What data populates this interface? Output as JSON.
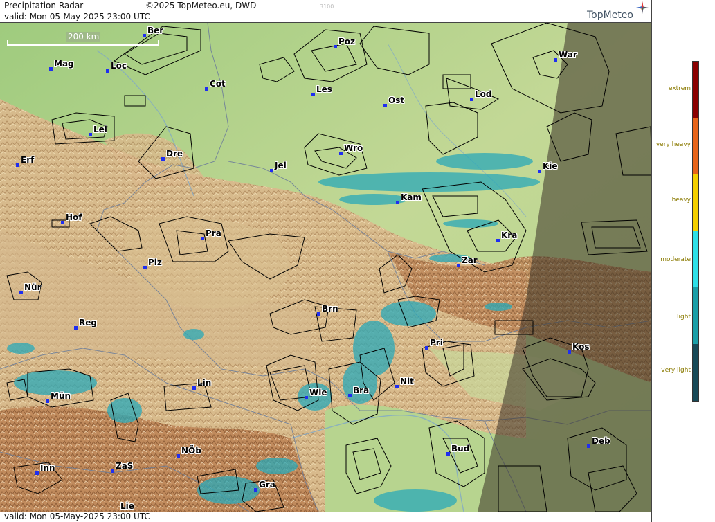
{
  "header": {
    "title": "Precipitation Radar",
    "copyright": "©2025 TopMeteo.eu, DWD",
    "valid": "valid:  Mon  05-May-2025 23:00 UTC",
    "code": "3100",
    "brand": "TopMeteo"
  },
  "footer": {
    "valid": "valid:  Mon  05-May-2025 23:00 UTC"
  },
  "scale": {
    "label": "200 km"
  },
  "cities": [
    {
      "name": "Ber"
    },
    {
      "name": "Poz"
    },
    {
      "name": "War"
    },
    {
      "name": "Mag"
    },
    {
      "name": "Loc"
    },
    {
      "name": "Cot"
    },
    {
      "name": "Les"
    },
    {
      "name": "Lod"
    },
    {
      "name": "Ost"
    },
    {
      "name": "Lei"
    },
    {
      "name": "Dre"
    },
    {
      "name": "Wro"
    },
    {
      "name": "Erf"
    },
    {
      "name": "Jel"
    },
    {
      "name": "Kie"
    },
    {
      "name": "Kam"
    },
    {
      "name": "Hof"
    },
    {
      "name": "Pra"
    },
    {
      "name": "Kra"
    },
    {
      "name": "Zar"
    },
    {
      "name": "Plz"
    },
    {
      "name": "Nür"
    },
    {
      "name": "Brn"
    },
    {
      "name": "Reg"
    },
    {
      "name": "Kos"
    },
    {
      "name": "Pri"
    },
    {
      "name": "Lin"
    },
    {
      "name": "Nit"
    },
    {
      "name": "Wie"
    },
    {
      "name": "Bra"
    },
    {
      "name": "Mün"
    },
    {
      "name": "Deb"
    },
    {
      "name": "Bud"
    },
    {
      "name": "NÖb"
    },
    {
      "name": "ZaS"
    },
    {
      "name": "Inn"
    },
    {
      "name": "Gra"
    },
    {
      "name": "Lie"
    }
  ],
  "legend": {
    "levels": [
      {
        "label": "extrem",
        "color": "#8b0000"
      },
      {
        "label": "very heavy",
        "color": "#e8651a"
      },
      {
        "label": "heavy",
        "color": "#f5d000"
      },
      {
        "label": "moderate",
        "color": "#2ee0e8"
      },
      {
        "label": "light",
        "color": "#1a9fa8"
      },
      {
        "label": "very light",
        "color": "#174a58"
      }
    ]
  },
  "colors": {
    "lowland": "#a9cf86",
    "hills": "#d8c99a",
    "mountains": "#c79a6e",
    "night_shade": "#5a4a3a",
    "radar_light": "#2bb8c4",
    "city_dot": "#1f2ef0"
  }
}
